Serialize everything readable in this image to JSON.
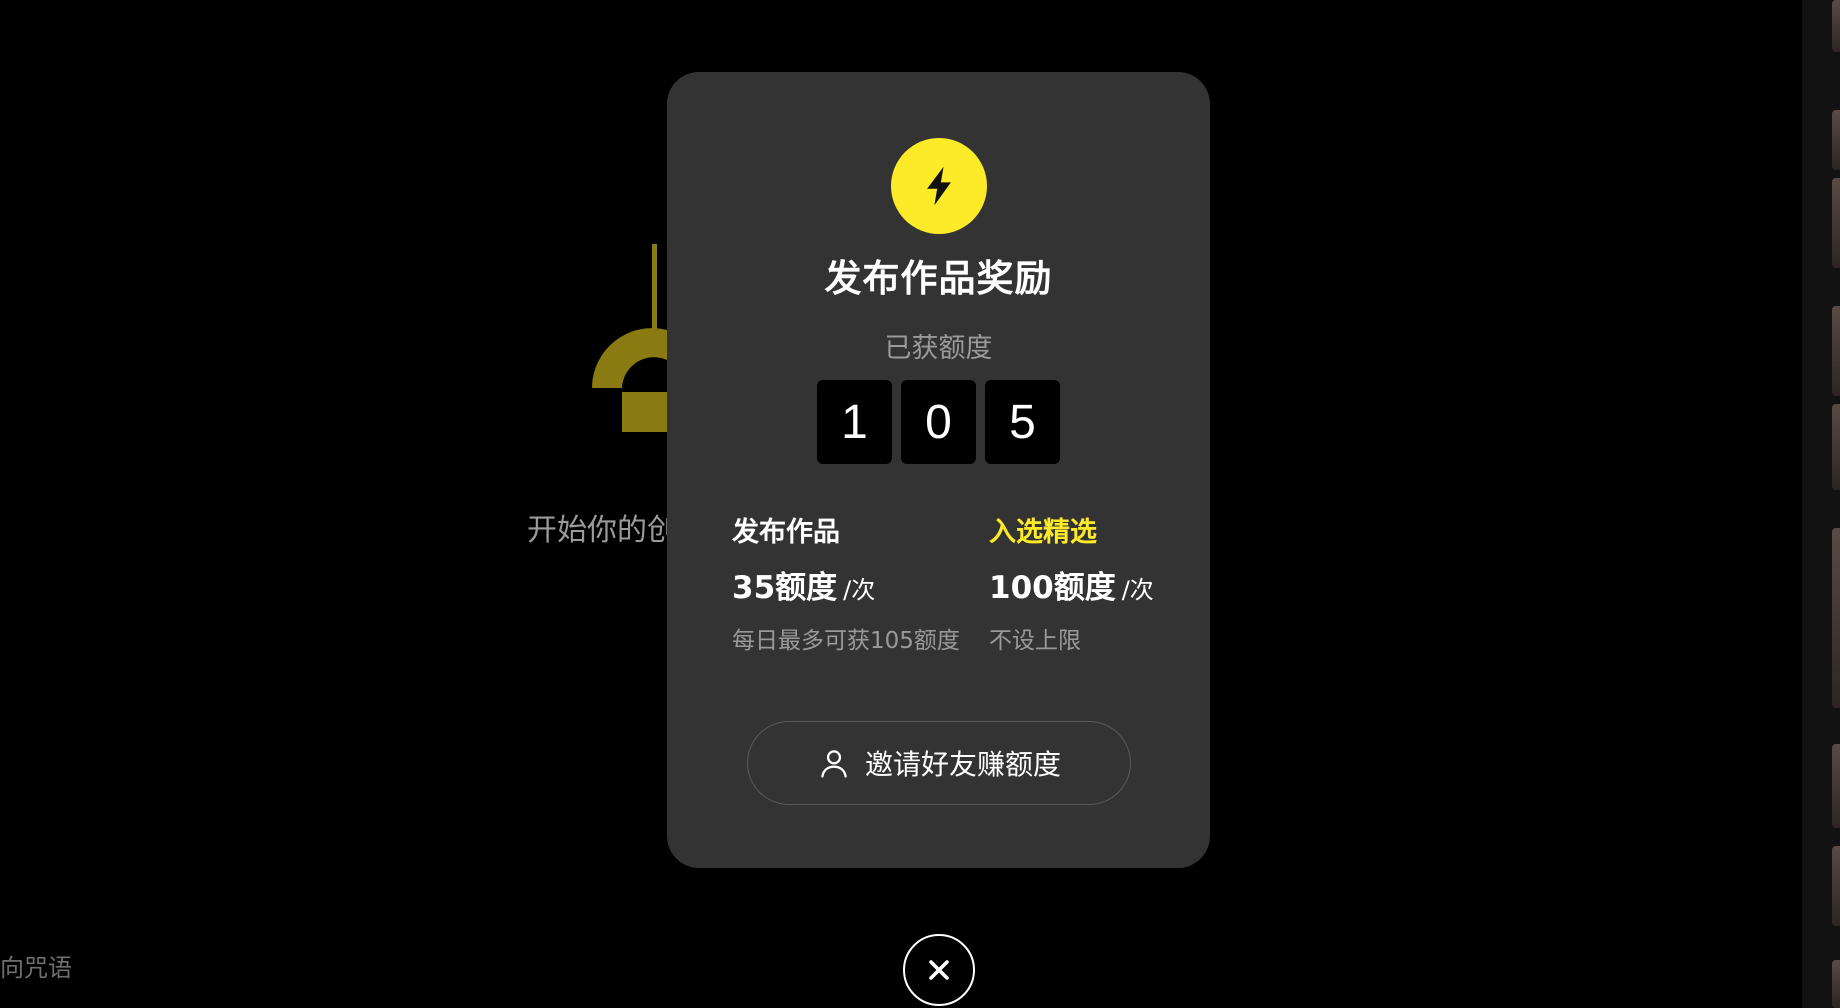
{
  "background": {
    "start_text": "开始你的创",
    "bottom_text": "向咒语",
    "accent_color": "#8a7a12"
  },
  "modal": {
    "icon": "lightning-bolt-icon",
    "title": "发布作品奖励",
    "subtitle": "已获额度",
    "credits_digits": [
      "1",
      "0",
      "5"
    ],
    "rewards": [
      {
        "label": "发布作品",
        "amount": "35额度",
        "unit": "/次",
        "note": "每日最多可获105额度",
        "label_color": "#ffffff"
      },
      {
        "label": "入选精选",
        "amount": "100额度",
        "unit": "/次",
        "note": "不设上限",
        "label_color": "#fdea29"
      }
    ],
    "invite_button": {
      "icon": "user-icon",
      "label": "邀请好友赚额度"
    }
  },
  "close_button": {
    "icon": "close-icon"
  },
  "colors": {
    "accent": "#fdea29",
    "modal_bg": "#333333",
    "page_bg": "#000000"
  }
}
